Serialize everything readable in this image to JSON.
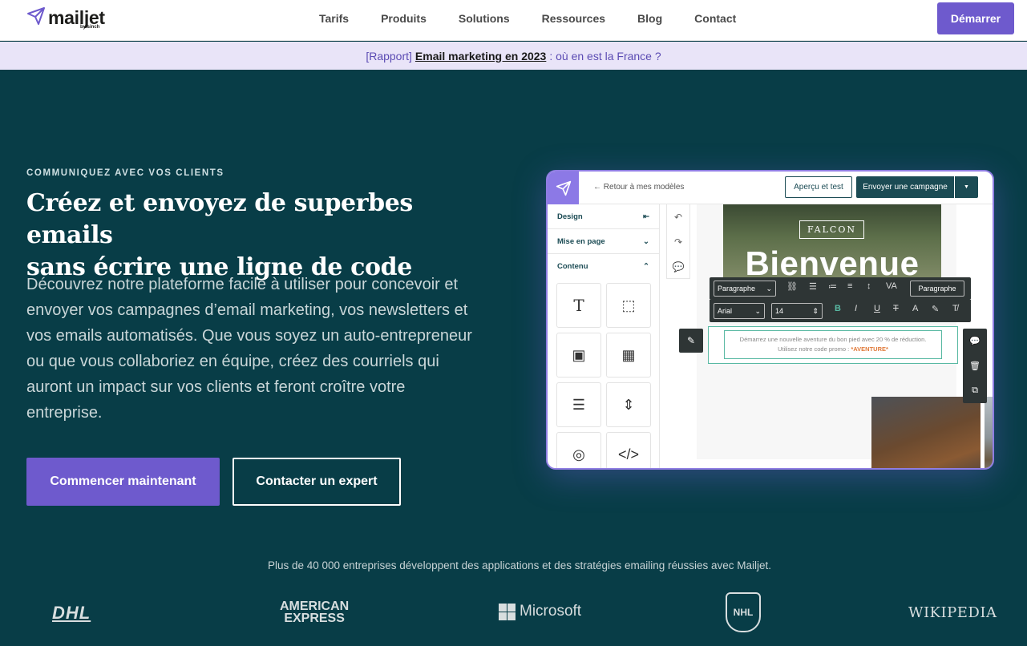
{
  "nav": {
    "logo": "mailjet",
    "logo_sub": "by sinch",
    "links": [
      "Tarifs",
      "Produits",
      "Solutions",
      "Ressources",
      "Blog",
      "Contact"
    ],
    "cta": "Démarrer"
  },
  "banner": {
    "prefix": "[Rapport]",
    "strong": "Email marketing en 2023",
    "suffix": ": où en est la France ?"
  },
  "hero": {
    "eyebrow": "COMMUNIQUEZ AVEC VOS CLIENTS",
    "headline_1": "Créez et envoyez de superbes emails",
    "headline_2": "sans écrire une ligne de code",
    "lead": "Découvrez notre plateforme facile à utiliser pour concevoir et envoyer vos campagnes d’email marketing, vos newsletters et vos emails automatisés. Que vous soyez un auto-entrepreneur ou que vous collaboriez en équipe, créez des courriels qui auront un impact sur vos clients et feront croître votre entreprise.",
    "primary_button": "Commencer maintenant",
    "secondary_button": "Contacter un expert"
  },
  "editor": {
    "back": "Retour à mes modèles",
    "preview": "Aperçu et test",
    "send": "Envoyer une campagne",
    "sidebar": [
      "Design",
      "Mise en page",
      "Contenu"
    ],
    "brand": "FALCON",
    "headline": "Bienvenue",
    "toolbar_style": "Paragraphe",
    "toolbar_style_btn": "Paragraphe",
    "toolbar_font": "Arial",
    "toolbar_size": "14",
    "text_line1": "Démarrez une nouvelle aventure du bon pied avec 20 % de réduction.",
    "text_line2": "Utilisez notre code promo :",
    "text_code": "*AVENTURE*"
  },
  "trust": {
    "text": "Plus de 40 000 entreprises développent des applications et des stratégies emailing réussies avec Mailjet.",
    "logos": {
      "dhl": "DHL",
      "amex_1": "AMERICAN",
      "amex_2": "EXPRESS",
      "microsoft": "Microsoft",
      "nhl": "NHL",
      "wikipedia": "WIKIPEDIA"
    }
  }
}
